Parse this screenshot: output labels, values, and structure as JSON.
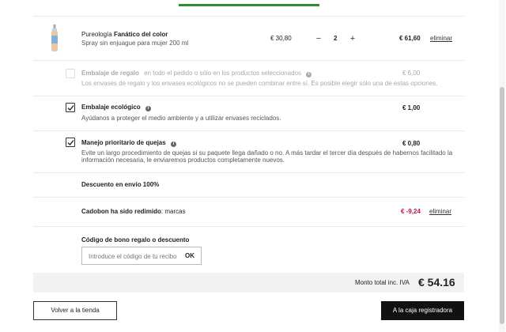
{
  "product": {
    "brand": "Pureología",
    "name": "Fanático del color",
    "description": "Spray sin enjuague para mujer 200 ml",
    "unit_price": "€ 30,80",
    "quantity": "2",
    "decrement": "−",
    "increment": "+",
    "total": "€ 61,60",
    "remove_label": "eliminar"
  },
  "gift_wrap": {
    "title": "Embalaje de regalo",
    "note": "en todo el pedido o sólo en los productos seleccionados",
    "price": "€ 6,00",
    "description": "Los envases de regalo y los envases ecológicos no se pueden combinar entre sí. Es posible elegir sólo una de estas opciones."
  },
  "eco_pack": {
    "title": "Embalaje ecológico",
    "price": "€ 1,00",
    "description": "Ayúdanos a proteger el medio ambiente y a utilizar envases reciclados."
  },
  "priority": {
    "title": "Manejo prioritario de quejas",
    "price": "€ 0,80",
    "description_line1": "Evite un largo procedimiento de quejas si su paquete llega dañado o no. A más tardar el tercer día después de habernos facilitado la",
    "description_line2": "información necesaria, le enviaremos productos completamente nuevos."
  },
  "shipping_discount": "Descuento en envío 100%",
  "cadobon": {
    "label_bold": "Cadobon ha sido redimido",
    "label_rest": ": marcas",
    "value": "€ -9,24",
    "remove_label": "eliminar"
  },
  "coupon": {
    "title": "Código de bono regalo o descuento",
    "placeholder": "Introduce el código de tu recibo",
    "ok_label": "OK"
  },
  "total": {
    "label": "Monto total inc. IVA",
    "value": "€ 54.16"
  },
  "buttons": {
    "back": "Volver a la tienda",
    "checkout": "A la caja registradora"
  },
  "colors": {
    "accent_green": "#2f8f2f",
    "discount_pink": "#c3105a",
    "primary_dark": "#111111"
  }
}
